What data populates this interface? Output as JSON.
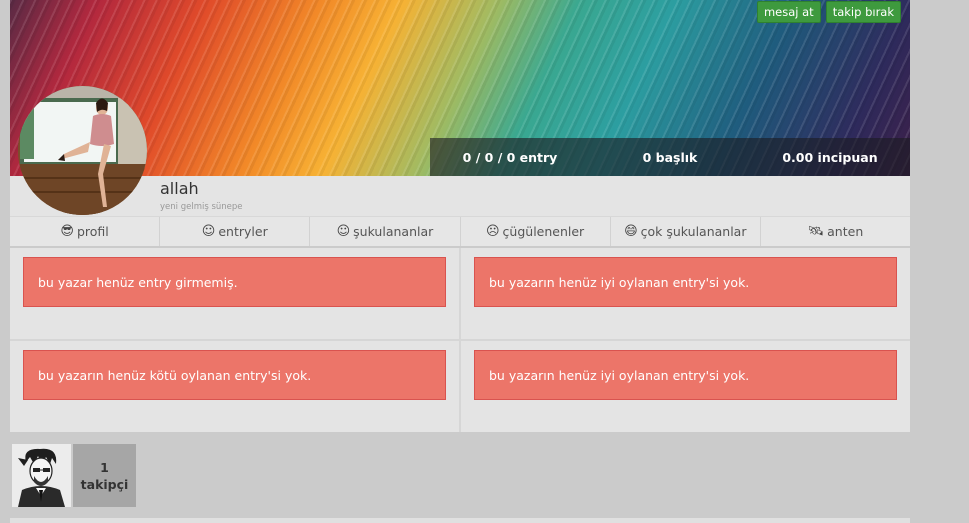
{
  "banner": {
    "message_button": "mesaj at",
    "unfollow_button": "takip bırak"
  },
  "stats": {
    "entry": "0 / 0 / 0 entry",
    "baslik": "0 başlık",
    "incipuan": "0.00 incipuan"
  },
  "user": {
    "name": "allah",
    "title": "yeni gelmiş sünepe"
  },
  "tabs": [
    {
      "icon": "😎",
      "label": "profil"
    },
    {
      "icon": "☺",
      "label": "entryler"
    },
    {
      "icon": "☺",
      "label": "şukulananlar"
    },
    {
      "icon": "☹",
      "label": "çügülenenler"
    },
    {
      "icon": "😄",
      "label": "çok şukulananlar"
    },
    {
      "icon": "🛰",
      "label": "anten"
    }
  ],
  "panels": [
    "bu yazar henüz entry girmemiş.",
    "bu yazarın henüz iyi oylanan entry'si yok.",
    "bu yazarın henüz kötü oylanan entry'si yok.",
    "bu yazarın henüz iyi oylanan entry'si yok."
  ],
  "followers": {
    "count": "1",
    "label": "takipçi"
  },
  "colors": {
    "alert_bg": "#ec7569",
    "alert_border": "#d9534f",
    "button_green": "#3e9a3e"
  }
}
